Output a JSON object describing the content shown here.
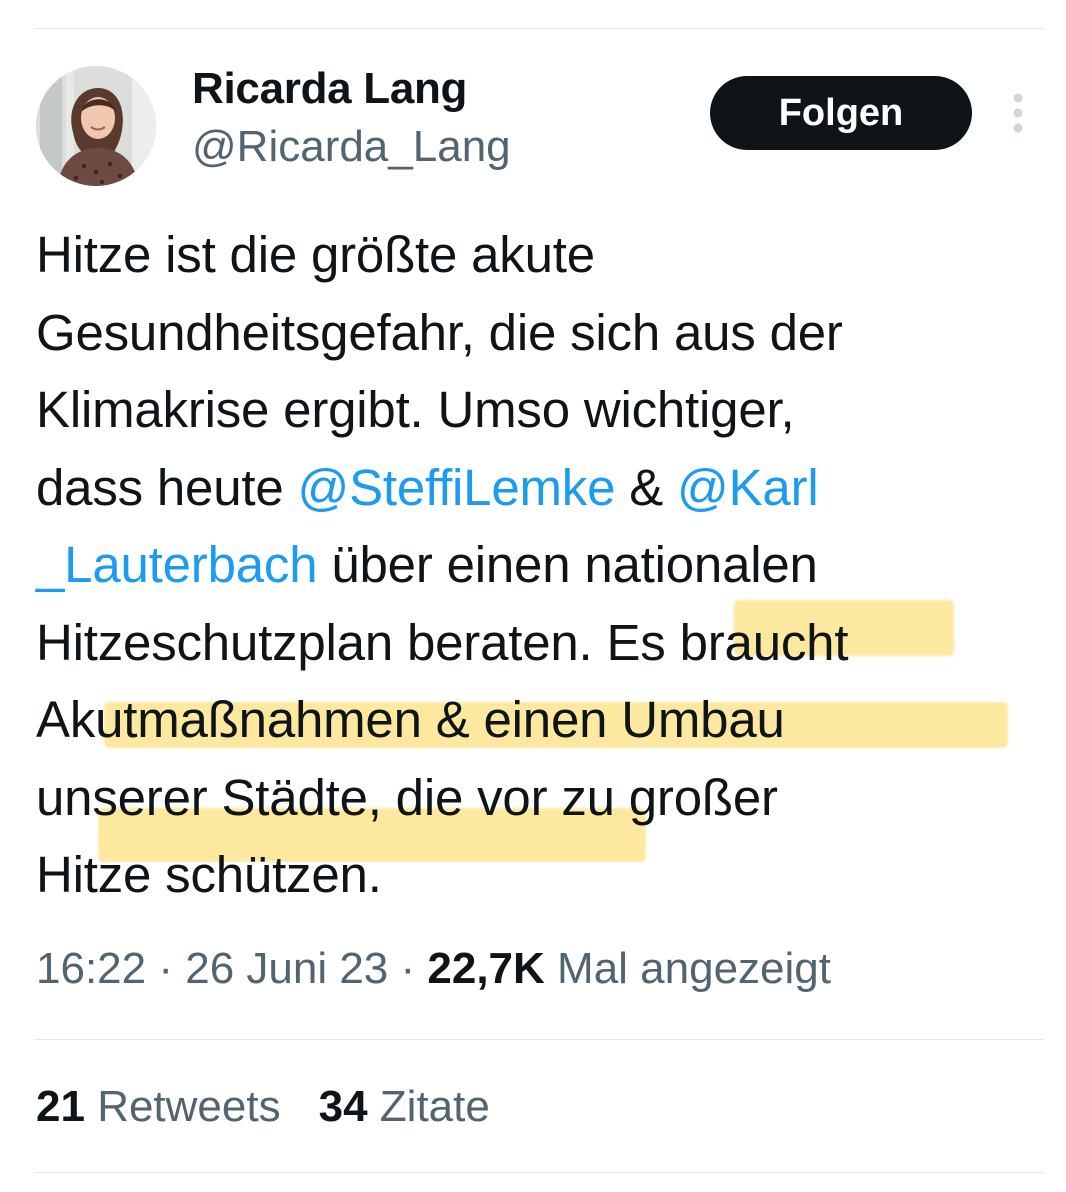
{
  "author": {
    "display_name": "Ricarda Lang",
    "handle": "@Ricarda_Lang"
  },
  "follow_label": "Folgen",
  "tweet": {
    "lines": [
      [
        {
          "t": "Hitze ist die größte akute"
        }
      ],
      [
        {
          "t": "Gesundheitsgefahr, die sich aus der"
        }
      ],
      [
        {
          "t": "Klimakrise ergibt. Umso wichtiger,"
        }
      ],
      [
        {
          "t": "dass heute "
        },
        {
          "t": "@SteffiLemke",
          "m": true
        },
        {
          "t": " & "
        },
        {
          "t": "@Karl",
          "m": true
        }
      ],
      [
        {
          "t": "_Lauterbach",
          "m": true
        },
        {
          "t": " über einen nationalen"
        }
      ],
      [
        {
          "t": "Hitzeschutzplan beraten. Es braucht"
        }
      ],
      [
        {
          "t": "Akutmaßnahmen & einen Umbau"
        }
      ],
      [
        {
          "t": "unserer Städte, die vor zu großer"
        }
      ],
      [
        {
          "t": "Hitze schützen."
        }
      ]
    ]
  },
  "meta": {
    "time": "16:22",
    "sep1": " · ",
    "date": "26 Juni 23",
    "sep2": " · ",
    "views_count": "22,7K",
    "views_label": " Mal angezeigt"
  },
  "stats": {
    "retweets_count": "21",
    "retweets_label": "Retweets",
    "quotes_count": "34",
    "quotes_label": "Zitate"
  },
  "colors": {
    "mention": "#1d9bf0",
    "highlight": "#fad650",
    "button_bg": "#0f1419",
    "secondary_text": "#536471"
  }
}
